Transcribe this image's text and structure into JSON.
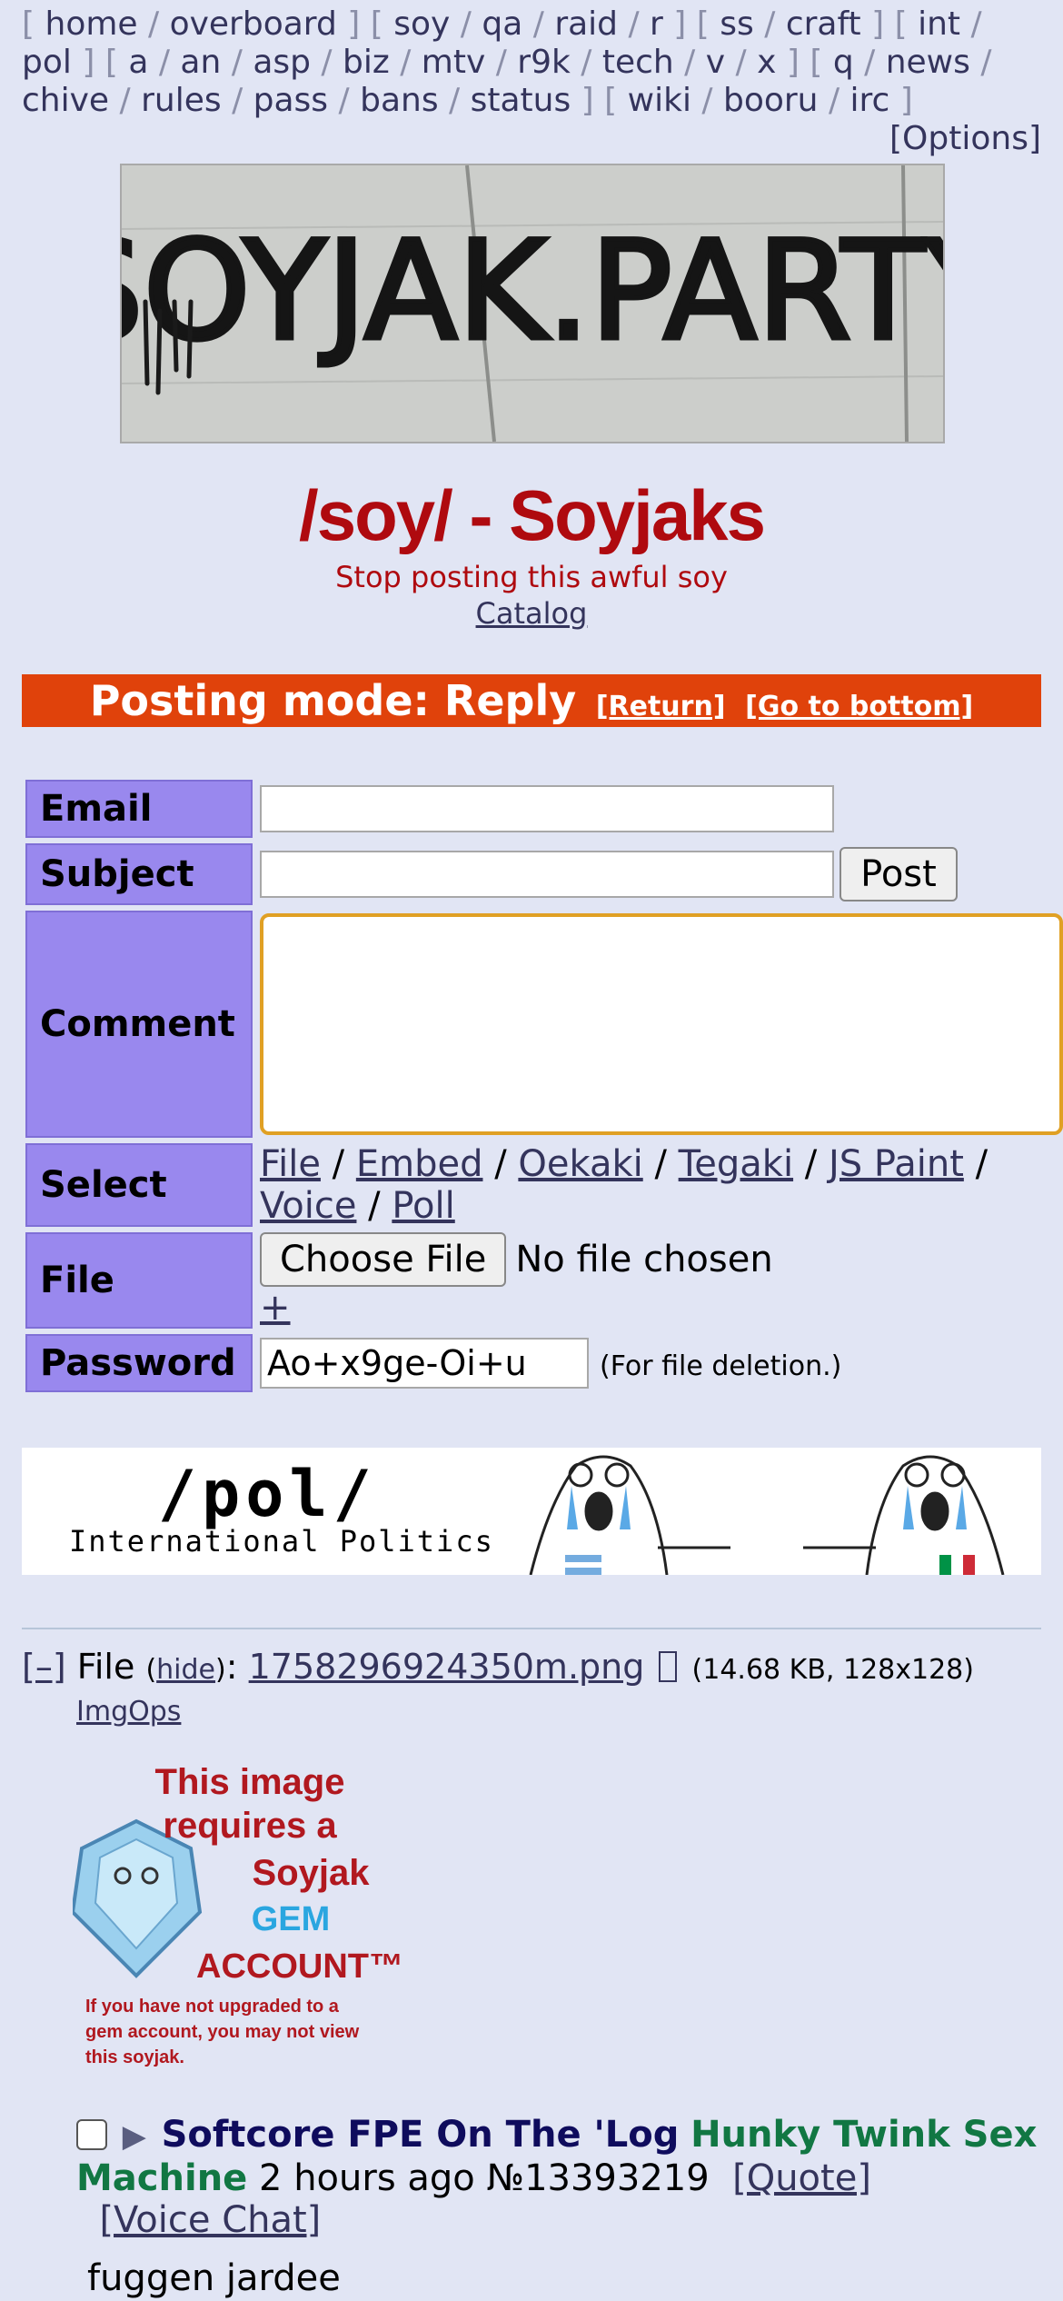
{
  "nav": {
    "groups": [
      [
        "home",
        "overboard"
      ],
      [
        "soy",
        "qa",
        "raid",
        "r"
      ],
      [
        "ss",
        "craft"
      ],
      [
        "int",
        "pol"
      ],
      [
        "a",
        "an",
        "asp",
        "biz",
        "mtv",
        "r9k",
        "tech",
        "v",
        "x"
      ],
      [
        "q",
        "news",
        "chive",
        "rules",
        "pass",
        "bans",
        "status"
      ],
      [
        "wiki",
        "booru",
        "irc"
      ]
    ],
    "options_label": "[Options]"
  },
  "banner": {
    "text": "SOYJAK.PARTY"
  },
  "board": {
    "title": "/soy/ - Soyjaks",
    "subtitle": "Stop posting this awful soy",
    "catalog_label": "Catalog"
  },
  "posting_mode": {
    "title": "Posting mode: Reply",
    "return_label": "[Return]",
    "bottom_label": "[Go to bottom]"
  },
  "form": {
    "email_label": "Email",
    "subject_label": "Subject",
    "post_button": "Post",
    "comment_label": "Comment",
    "select_label": "Select",
    "select_options": [
      "File",
      "Embed",
      "Oekaki",
      "Tegaki",
      "JS Paint",
      "Voice",
      "Poll"
    ],
    "file_label": "File",
    "choose_file": "Choose File",
    "no_file": "No file chosen",
    "add_more": "+",
    "password_label": "Password",
    "password_value": "Ao+x9ge-Oi+u",
    "password_note": "(For file deletion.)"
  },
  "ad": {
    "title": "/pol/",
    "subtitle": "International Politics"
  },
  "post": {
    "toggle": "[–]",
    "file_prefix": "File",
    "hide_label": "hide",
    "filename": "1758296924350m.png",
    "file_meta": "(14.68 KB, 128x128)",
    "imgops_label": "ImgOps",
    "gem_text": {
      "line1": "This image",
      "line2": "requires a",
      "line3": "Soyjak",
      "line4": "GEM",
      "line5": "ACCOUNT™",
      "fine1": "If you have not upgraded to a",
      "fine2": "gem account, you may not view",
      "fine3": "this soyjak."
    },
    "subject": "Softcore FPE On The 'Log",
    "name": "Hunky Twink Sex Machine",
    "time": "2 hours ago",
    "number": "№13393219",
    "quote_label": "[Quote]",
    "voice_label": "[Voice Chat]",
    "body": "fuggen jardee"
  },
  "colors": {
    "background": "#e1e5f4",
    "title_red": "#af0a0f",
    "posting_mode_bg": "#e0420b",
    "label_bg": "#9988ee",
    "subject_color": "#0f0c5d",
    "name_color": "#117743",
    "link_color": "#34345c"
  }
}
